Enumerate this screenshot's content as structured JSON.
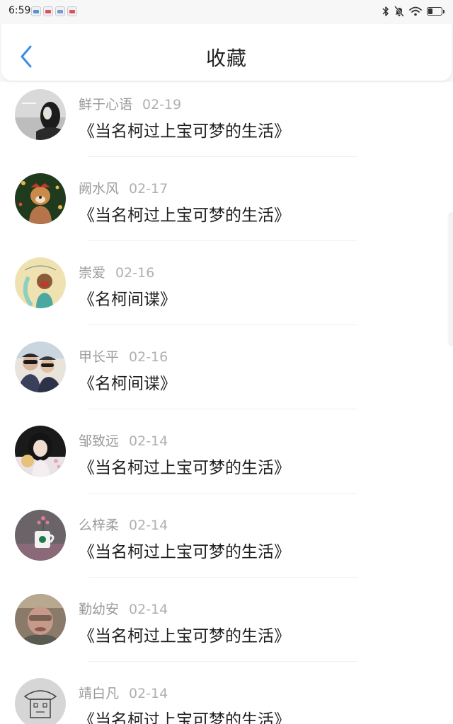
{
  "status_bar": {
    "time": "6:59",
    "notification_icons": [
      "app-notification-icon",
      "red-app-notification-icon",
      "shield-app-notification-icon",
      "red-app-notification-icon"
    ],
    "system_icons": [
      "bluetooth-icon",
      "mute-icon",
      "wifi-icon",
      "battery-icon"
    ],
    "battery_level": 0.35
  },
  "header": {
    "back_icon": "chevron-left-icon",
    "title": "收藏",
    "accent_color": "#3a8ee6"
  },
  "items": [
    {
      "user": "鲜于心语",
      "date": "02-19",
      "title": "《当名柯过上宝可梦的生活》",
      "avatar": "grey-portrait-avatar"
    },
    {
      "user": "阙水风",
      "date": "02-17",
      "title": "《当名柯过上宝可梦的生活》",
      "avatar": "dog-avatar"
    },
    {
      "user": "崇爱",
      "date": "02-16",
      "title": "《名柯间谍》",
      "avatar": "cartoon-girl-avatar"
    },
    {
      "user": "甲长平",
      "date": "02-16",
      "title": "《名柯间谍》",
      "avatar": "couple-photo-avatar"
    },
    {
      "user": "邹致远",
      "date": "02-14",
      "title": "《当名柯过上宝可梦的生活》",
      "avatar": "girl-portrait-avatar"
    },
    {
      "user": "么梓柔",
      "date": "02-14",
      "title": "《当名柯过上宝可梦的生活》",
      "avatar": "coffee-cup-avatar"
    },
    {
      "user": "勤幼安",
      "date": "02-14",
      "title": "《当名柯过上宝可梦的生活》",
      "avatar": "blurry-face-avatar"
    },
    {
      "user": "靖白凡",
      "date": "02-14",
      "title": "《当名柯过上宝可梦的生活》",
      "avatar": "sketch-drawing-avatar"
    }
  ]
}
